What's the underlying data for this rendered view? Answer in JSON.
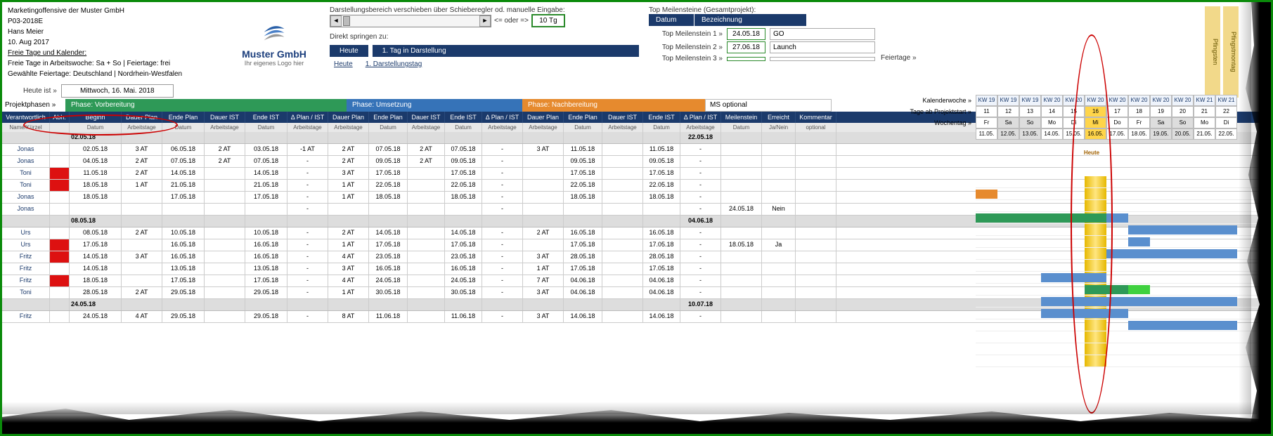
{
  "info": {
    "title": "Marketingoffensive der Muster GmbH",
    "project_no": "P03-2018E",
    "author": "Hans Meier",
    "date": "10. Aug 2017",
    "free_days_header": "Freie Tage und Kalender:",
    "free_days_line": "Freie Tage in Arbeitswoche: Sa + So | Feiertage: frei",
    "holidays_line": "Gewählte Feiertage: Deutschland | Nordrhein-Westfalen"
  },
  "logo": {
    "name": "Muster GmbH",
    "sub": "Ihr eigenes Logo hier"
  },
  "controls": {
    "slider_label": "Darstellungsbereich verschieben über Schieberegler od. manuelle Eingabe:",
    "oder_label": "<= oder =>",
    "days_value": "10 Tg",
    "jump_label": "Direkt springen zu:",
    "jump_heute": "Heute",
    "jump_first": "1. Tag in Darstellung",
    "link_heute": "Heute",
    "link_first": "1. Darstellungstag"
  },
  "milestones": {
    "header_title": "Top Meilensteine (Gesamtprojekt):",
    "col_date": "Datum",
    "col_desc": "Bezeichnung",
    "rows": [
      {
        "label": "Top Meilenstein 1 »",
        "date": "24.05.18",
        "text": "GO"
      },
      {
        "label": "Top Meilenstein 2 »",
        "date": "27.06.18",
        "text": "Launch"
      },
      {
        "label": "Top Meilenstein 3 »",
        "date": "",
        "text": ""
      }
    ]
  },
  "heute": {
    "label": "Heute ist »",
    "value": "Mittwoch, 16. Mai. 2018"
  },
  "phases": {
    "label": "Projektphasen »",
    "p1": "Phase: Vorbereitung",
    "p2": "Phase: Umsetzung",
    "p3": "Phase: Nachbereitung",
    "ms_opt": "MS optional"
  },
  "columns": {
    "verant": "Verantwortlich",
    "abh": "Abh.",
    "beginn": "Beginn",
    "dplan": "Dauer Plan",
    "eplan": "Ende Plan",
    "dist": "Dauer IST",
    "eist": "Ende IST",
    "delta": "Δ Plan / IST",
    "dplan2": "Dauer Plan",
    "eplan2": "Ende Plan",
    "dist2": "Dauer IST",
    "eist2": "Ende IST",
    "delta2": "Δ Plan / IST",
    "dplan3": "Dauer Plan",
    "eplan3": "Ende Plan",
    "dist3": "Dauer IST",
    "eist3": "Ende IST",
    "delta3": "Δ Plan / IST",
    "ms": "Meilenstein",
    "err": "Erreicht",
    "kom": "Kommentar"
  },
  "sub": {
    "verant": "Name/Kürzel",
    "abh": "",
    "beginn": "Datum",
    "dplan": "Arbeitstage",
    "eplan": "Datum",
    "dist": "Arbeitstage",
    "eist": "Datum",
    "delta": "Arbeitstage",
    "dplan2": "Arbeitstage",
    "eplan2": "Datum",
    "dist2": "Arbeitstage",
    "eist2": "Datum",
    "delta2": "Arbeitstage",
    "dplan3": "Arbeitstage",
    "eplan3": "Datum",
    "dist3": "Arbeitstage",
    "eist3": "Datum",
    "delta3": "Arbeitstage",
    "ms": "Datum",
    "err": "Ja/Nein",
    "kom": "optional"
  },
  "sections": [
    {
      "start": "02.05.18",
      "end": "22.05.18",
      "rows": [
        {
          "n": "Jonas",
          "r": false,
          "b": "02.05.18",
          "dp": "3 AT",
          "ep": "06.05.18",
          "di": "2 AT",
          "ei": "03.05.18",
          "d": "-1 AT",
          "dp2": "2 AT",
          "ep2": "07.05.18",
          "di2": "2 AT",
          "ei2": "07.05.18",
          "d2": "-",
          "dp3": "3 AT",
          "ep3": "11.05.18",
          "di3": "",
          "ei3": "11.05.18",
          "d3": "-",
          "ms": "",
          "er": "",
          "km": ""
        },
        {
          "n": "Jonas",
          "r": false,
          "b": "04.05.18",
          "dp": "2 AT",
          "ep": "07.05.18",
          "di": "2 AT",
          "ei": "07.05.18",
          "d": "-",
          "dp2": "2 AT",
          "ep2": "09.05.18",
          "di2": "2 AT",
          "ei2": "09.05.18",
          "d2": "-",
          "dp3": "",
          "ep3": "09.05.18",
          "di3": "",
          "ei3": "09.05.18",
          "d3": "-",
          "ms": "",
          "er": "",
          "km": ""
        },
        {
          "n": "Toni",
          "r": true,
          "b": "11.05.18",
          "dp": "2 AT",
          "ep": "14.05.18",
          "di": "",
          "ei": "14.05.18",
          "d": "-",
          "dp2": "3 AT",
          "ep2": "17.05.18",
          "di2": "",
          "ei2": "17.05.18",
          "d2": "-",
          "dp3": "",
          "ep3": "17.05.18",
          "di3": "",
          "ei3": "17.05.18",
          "d3": "-",
          "ms": "",
          "er": "",
          "km": ""
        },
        {
          "n": "Toni",
          "r": true,
          "b": "18.05.18",
          "dp": "1 AT",
          "ep": "21.05.18",
          "di": "",
          "ei": "21.05.18",
          "d": "-",
          "dp2": "1 AT",
          "ep2": "22.05.18",
          "di2": "",
          "ei2": "22.05.18",
          "d2": "-",
          "dp3": "",
          "ep3": "22.05.18",
          "di3": "",
          "ei3": "22.05.18",
          "d3": "-",
          "ms": "",
          "er": "",
          "km": ""
        },
        {
          "n": "Jonas",
          "r": false,
          "b": "18.05.18",
          "dp": "",
          "ep": "17.05.18",
          "di": "",
          "ei": "17.05.18",
          "d": "-",
          "dp2": "1 AT",
          "ep2": "18.05.18",
          "di2": "",
          "ei2": "18.05.18",
          "d2": "-",
          "dp3": "",
          "ep3": "18.05.18",
          "di3": "",
          "ei3": "18.05.18",
          "d3": "-",
          "ms": "",
          "er": "",
          "km": ""
        },
        {
          "n": "Jonas",
          "r": false,
          "b": "",
          "dp": "",
          "ep": "",
          "di": "",
          "ei": "",
          "d": "-",
          "dp2": "",
          "ep2": "",
          "di2": "",
          "ei2": "",
          "d2": "-",
          "dp3": "",
          "ep3": "",
          "di3": "",
          "ei3": "",
          "d3": "-",
          "ms": "24.05.18",
          "er": "Nein",
          "km": ""
        }
      ]
    },
    {
      "start": "08.05.18",
      "end": "04.06.18",
      "rows": [
        {
          "n": "Urs",
          "r": false,
          "b": "08.05.18",
          "dp": "2 AT",
          "ep": "10.05.18",
          "di": "",
          "ei": "10.05.18",
          "d": "-",
          "dp2": "2 AT",
          "ep2": "14.05.18",
          "di2": "",
          "ei2": "14.05.18",
          "d2": "-",
          "dp3": "2 AT",
          "ep3": "16.05.18",
          "di3": "",
          "ei3": "16.05.18",
          "d3": "-",
          "ms": "",
          "er": "",
          "km": ""
        },
        {
          "n": "Urs",
          "r": true,
          "b": "17.05.18",
          "dp": "",
          "ep": "16.05.18",
          "di": "",
          "ei": "16.05.18",
          "d": "-",
          "dp2": "1 AT",
          "ep2": "17.05.18",
          "di2": "",
          "ei2": "17.05.18",
          "d2": "-",
          "dp3": "",
          "ep3": "17.05.18",
          "di3": "",
          "ei3": "17.05.18",
          "d3": "-",
          "ms": "18.05.18",
          "er": "Ja",
          "km": ""
        },
        {
          "n": "Fritz",
          "r": true,
          "b": "14.05.18",
          "dp": "3 AT",
          "ep": "16.05.18",
          "di": "",
          "ei": "16.05.18",
          "d": "-",
          "dp2": "4 AT",
          "ep2": "23.05.18",
          "di2": "",
          "ei2": "23.05.18",
          "d2": "-",
          "dp3": "3 AT",
          "ep3": "28.05.18",
          "di3": "",
          "ei3": "28.05.18",
          "d3": "-",
          "ms": "",
          "er": "",
          "km": ""
        },
        {
          "n": "Fritz",
          "r": false,
          "b": "14.05.18",
          "dp": "",
          "ep": "13.05.18",
          "di": "",
          "ei": "13.05.18",
          "d": "-",
          "dp2": "3 AT",
          "ep2": "16.05.18",
          "di2": "",
          "ei2": "16.05.18",
          "d2": "-",
          "dp3": "1 AT",
          "ep3": "17.05.18",
          "di3": "",
          "ei3": "17.05.18",
          "d3": "-",
          "ms": "",
          "er": "",
          "km": ""
        },
        {
          "n": "Fritz",
          "r": true,
          "b": "18.05.18",
          "dp": "",
          "ep": "17.05.18",
          "di": "",
          "ei": "17.05.18",
          "d": "-",
          "dp2": "4 AT",
          "ep2": "24.05.18",
          "di2": "",
          "ei2": "24.05.18",
          "d2": "-",
          "dp3": "7 AT",
          "ep3": "04.06.18",
          "di3": "",
          "ei3": "04.06.18",
          "d3": "-",
          "ms": "",
          "er": "",
          "km": ""
        },
        {
          "n": "Toni",
          "r": false,
          "b": "28.05.18",
          "dp": "2 AT",
          "ep": "29.05.18",
          "di": "",
          "ei": "29.05.18",
          "d": "-",
          "dp2": "1 AT",
          "ep2": "30.05.18",
          "di2": "",
          "ei2": "30.05.18",
          "d2": "-",
          "dp3": "3 AT",
          "ep3": "04.06.18",
          "di3": "",
          "ei3": "04.06.18",
          "d3": "-",
          "ms": "",
          "er": "",
          "km": ""
        }
      ]
    },
    {
      "start": "24.05.18",
      "end": "10.07.18",
      "rows": [
        {
          "n": "Fritz",
          "r": false,
          "b": "24.05.18",
          "dp": "4 AT",
          "ep": "29.05.18",
          "di": "",
          "ei": "29.05.18",
          "d": "-",
          "dp2": "8 AT",
          "ep2": "11.06.18",
          "di2": "",
          "ei2": "11.06.18",
          "d2": "-",
          "dp3": "3 AT",
          "ep3": "14.06.18",
          "di3": "",
          "ei3": "14.06.18",
          "d3": "-",
          "ms": "",
          "er": "",
          "km": ""
        }
      ]
    }
  ],
  "calendar": {
    "feiertage_label": "Feiertage »",
    "holidays": [
      "Pfingsten",
      "Pfingstmontag"
    ],
    "row_labels": [
      "Kalenderwoche »",
      "Tage ab Projektstart »",
      "Wochentag »",
      ""
    ],
    "heute_label": "Heute",
    "kw": [
      "KW 19",
      "KW 19",
      "KW 19",
      "KW 20",
      "KW 20",
      "KW 20",
      "KW 20",
      "KW 20",
      "KW 20",
      "KW 20",
      "KW 21",
      "KW 21"
    ],
    "days": [
      "11",
      "12",
      "13",
      "14",
      "15",
      "16",
      "17",
      "18",
      "19",
      "20",
      "21",
      "22"
    ],
    "wd": [
      "Fr",
      "Sa",
      "So",
      "Mo",
      "Di",
      "Mi",
      "Do",
      "Fr",
      "Sa",
      "So",
      "Mo",
      "Di"
    ],
    "dates": [
      "11.05.",
      "12.05.",
      "13.05.",
      "14.05.",
      "15.05.",
      "16.05.",
      "17.05.",
      "18.05.",
      "19.05.",
      "20.05.",
      "21.05.",
      "22.05."
    ],
    "weekend": [
      false,
      true,
      true,
      false,
      false,
      false,
      false,
      false,
      true,
      true,
      false,
      false
    ],
    "today_idx": 5
  },
  "gantt": [
    [],
    [
      {
        "s": 0,
        "w": 1,
        "c": "orange"
      }
    ],
    [],
    [
      {
        "s": 0,
        "w": 6,
        "c": "green"
      },
      {
        "s": 6,
        "w": 1,
        "c": "blue"
      }
    ],
    [
      {
        "s": 7,
        "w": 5,
        "c": "blue"
      }
    ],
    [
      {
        "s": 7,
        "w": 1,
        "c": "blue"
      }
    ],
    [
      {
        "s": 6,
        "w": 6,
        "c": "blue"
      }
    ],
    [],
    [
      {
        "s": 3,
        "w": 3,
        "c": "blue"
      }
    ],
    [
      {
        "s": 5,
        "w": 2,
        "c": "green"
      },
      {
        "s": 7,
        "w": 1,
        "c": "lime"
      }
    ],
    [
      {
        "s": 3,
        "w": 9,
        "c": "blue"
      }
    ],
    [
      {
        "s": 3,
        "w": 4,
        "c": "blue"
      }
    ],
    [
      {
        "s": 7,
        "w": 5,
        "c": "blue"
      }
    ],
    [],
    [],
    []
  ]
}
